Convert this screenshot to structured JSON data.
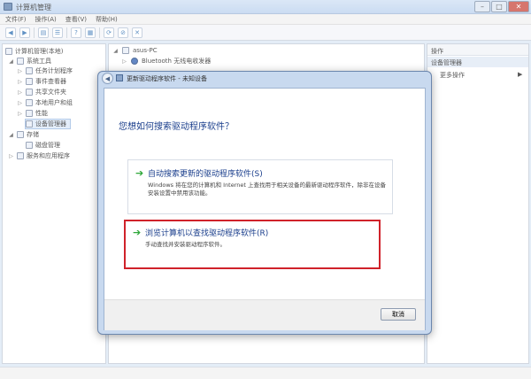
{
  "window": {
    "title": "计算机管理"
  },
  "menu": [
    "文件(F)",
    "操作(A)",
    "查看(V)",
    "帮助(H)"
  ],
  "toolbar_icons": [
    "back-icon",
    "forward-icon",
    "folder-icon",
    "list-icon",
    "refresh-icon",
    "help-icon",
    "properties-icon",
    "update-icon",
    "disable-icon",
    "uninstall-icon"
  ],
  "tree": {
    "root": "计算机管理(本地)",
    "system_tools": "系统工具",
    "task_scheduler": "任务计划程序",
    "event_viewer": "事件查看器",
    "shared_folders": "共享文件夹",
    "local_users": "本地用户和组",
    "performance": "性能",
    "device_manager": "设备管理器",
    "storage": "存储",
    "disk_management": "磁盘管理",
    "services": "服务和应用程序"
  },
  "center": {
    "computer": "asus-PC",
    "device1": "Bluetooth 无线电收发器"
  },
  "actions": {
    "header": "操作",
    "section": "设备管理器",
    "more": "更多操作"
  },
  "dialog": {
    "title": "更新驱动程序软件 - 未知设备",
    "question": "您想如何搜索驱动程序软件？",
    "option1_title": "自动搜索更新的驱动程序软件(S)",
    "option1_desc": "Windows 将在您的计算机和 Internet 上查找用于相关设备的最新驱动程序软件，除非在设备安装设置中禁用该功能。",
    "option2_title": "浏览计算机以查找驱动程序软件(R)",
    "option2_desc": "手动查找并安装驱动程序软件。",
    "cancel": "取消"
  },
  "colors": {
    "highlight_border": "#d0222a",
    "link_blue": "#1a3e8c",
    "arrow_green": "#2fa83a"
  }
}
